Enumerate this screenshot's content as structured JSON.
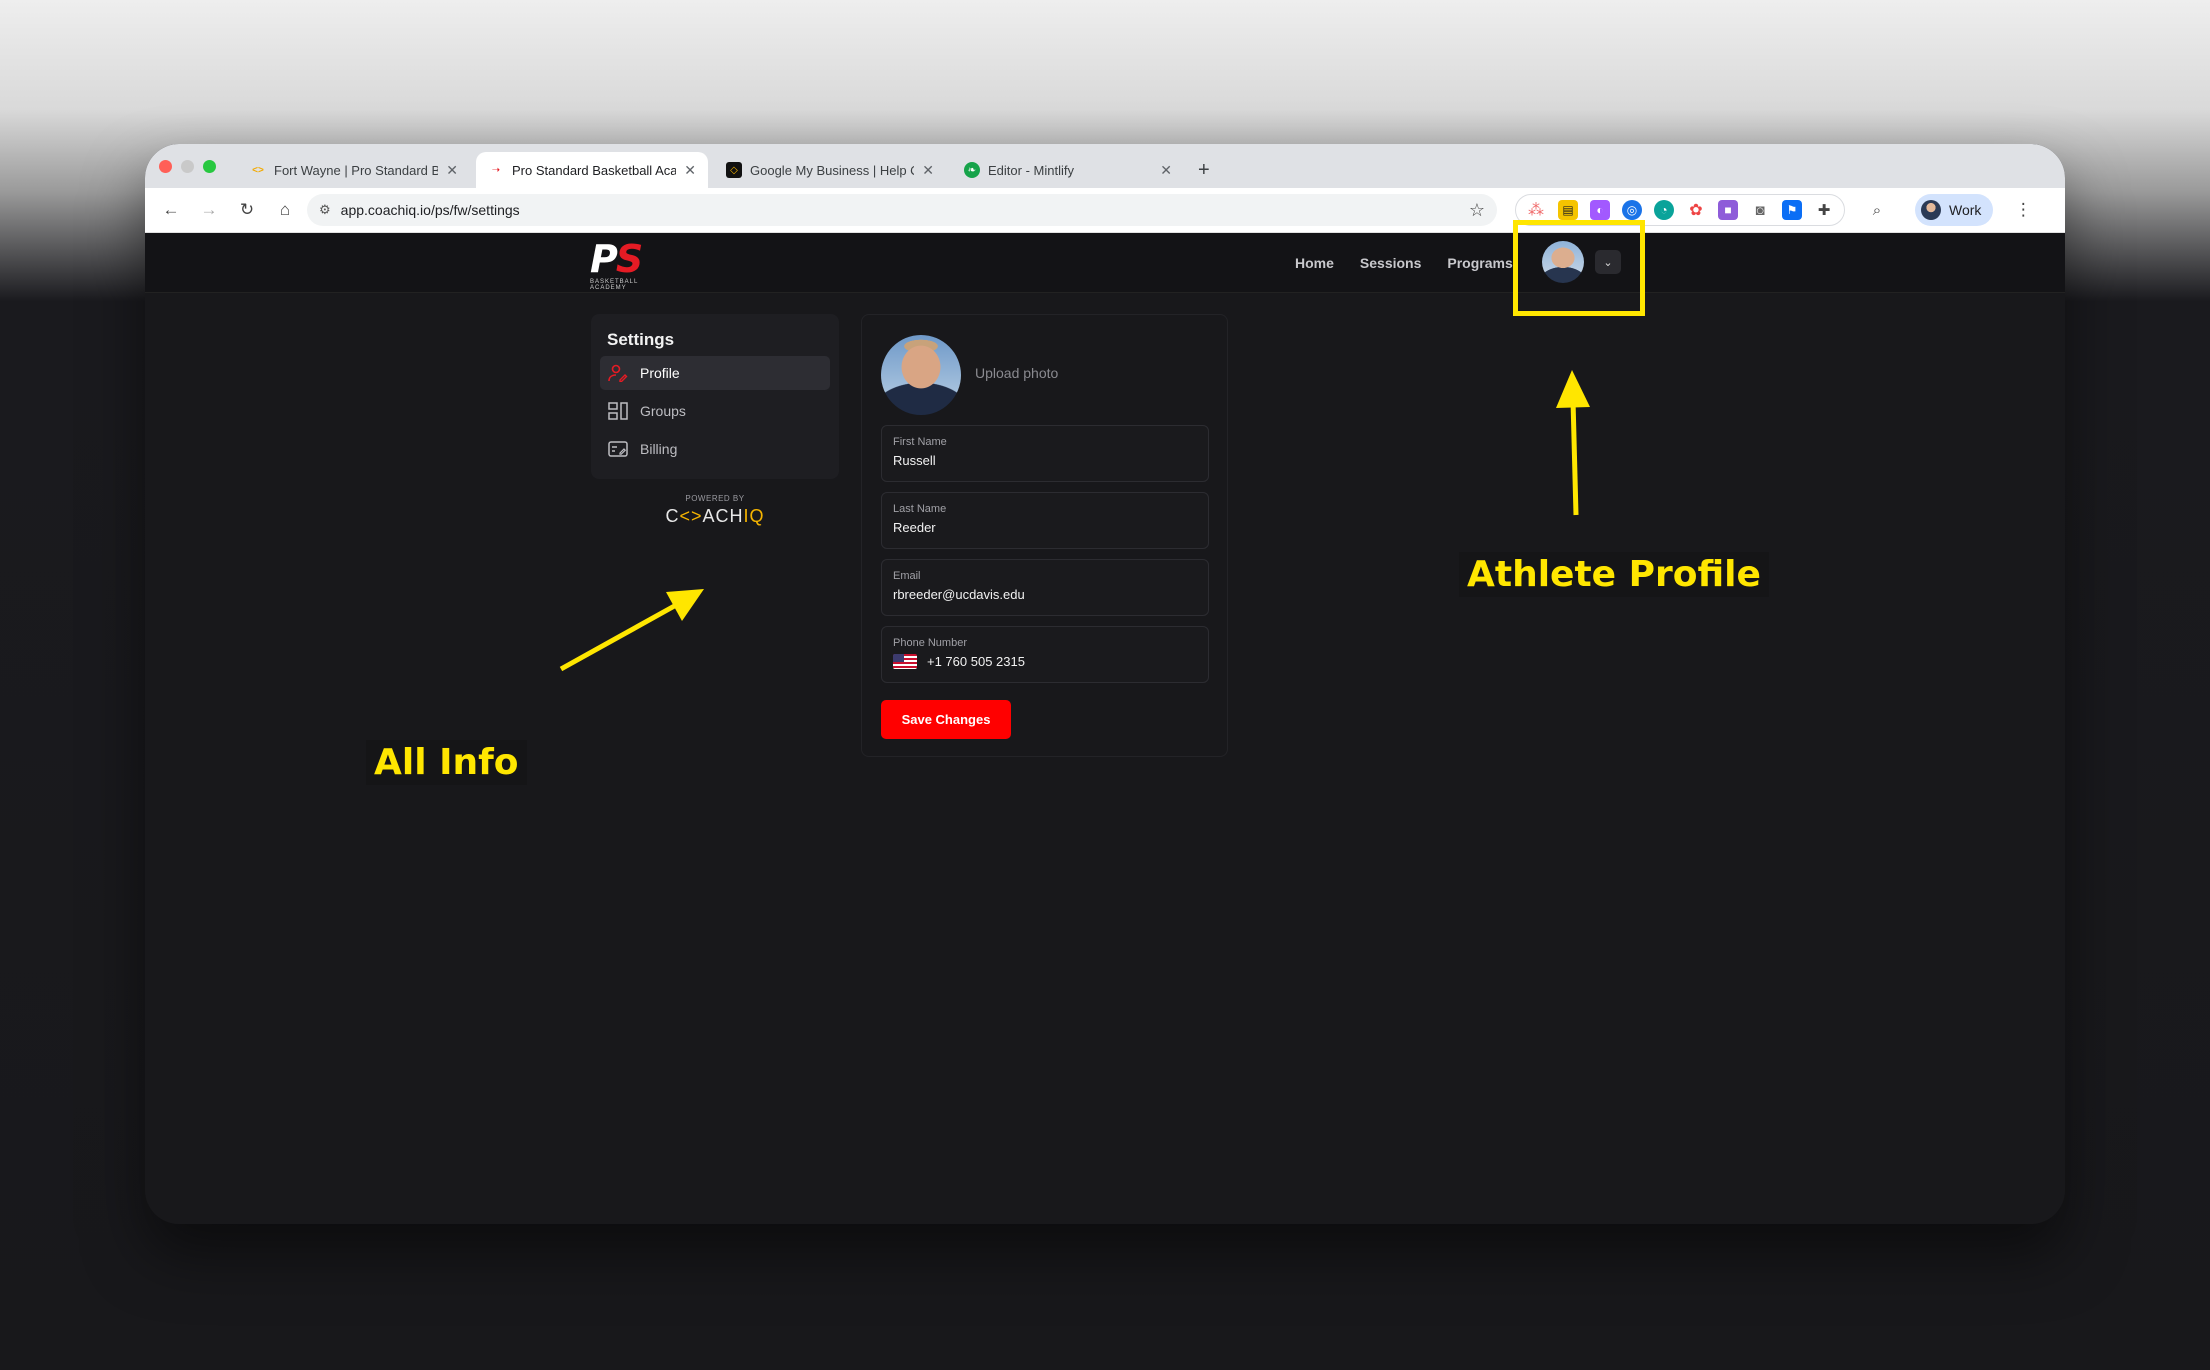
{
  "browser": {
    "tabs": [
      {
        "title": "Fort Wayne | Pro Standard Ba",
        "active": false,
        "favicon": "code-diamond-icon"
      },
      {
        "title": "Pro Standard Basketball Acad",
        "active": true,
        "favicon": "ps-logo-icon"
      },
      {
        "title": "Google My Business | Help C",
        "active": false,
        "favicon": "bracket-icon"
      },
      {
        "title": "Editor - Mintlify",
        "active": false,
        "favicon": "mintlify-leaf-icon"
      }
    ],
    "new_tab": "+",
    "url": "app.coachiq.io/ps/fw/settings",
    "profile_label": "Work"
  },
  "app": {
    "logo": {
      "mark_left": "P",
      "mark_right": "S",
      "subtitle": "BASKETBALL ACADEMY"
    },
    "nav": [
      "Home",
      "Sessions",
      "Programs"
    ],
    "sidebar": {
      "title": "Settings",
      "items": [
        {
          "label": "Profile",
          "icon": "user-edit-icon",
          "active": true
        },
        {
          "label": "Groups",
          "icon": "groups-icon",
          "active": false
        },
        {
          "label": "Billing",
          "icon": "billing-icon",
          "active": false
        }
      ]
    },
    "powered_by": {
      "label": "POWERED BY",
      "brand_a": "C",
      "brand_b": "<>",
      "brand_c": "ACH",
      "brand_d": "IQ"
    },
    "profile": {
      "upload_label": "Upload photo",
      "fields": [
        {
          "label": "First Name",
          "value": "Russell"
        },
        {
          "label": "Last Name",
          "value": "Reeder"
        },
        {
          "label": "Email",
          "value": "rbreeder@ucdavis.edu"
        },
        {
          "label": "Phone Number",
          "value": "+1 760 505 2315"
        }
      ],
      "save_label": "Save Changes"
    }
  },
  "annotations": {
    "athlete_profile": "Athlete Profile",
    "all_info": "All Info",
    "color": "#ffe600"
  }
}
